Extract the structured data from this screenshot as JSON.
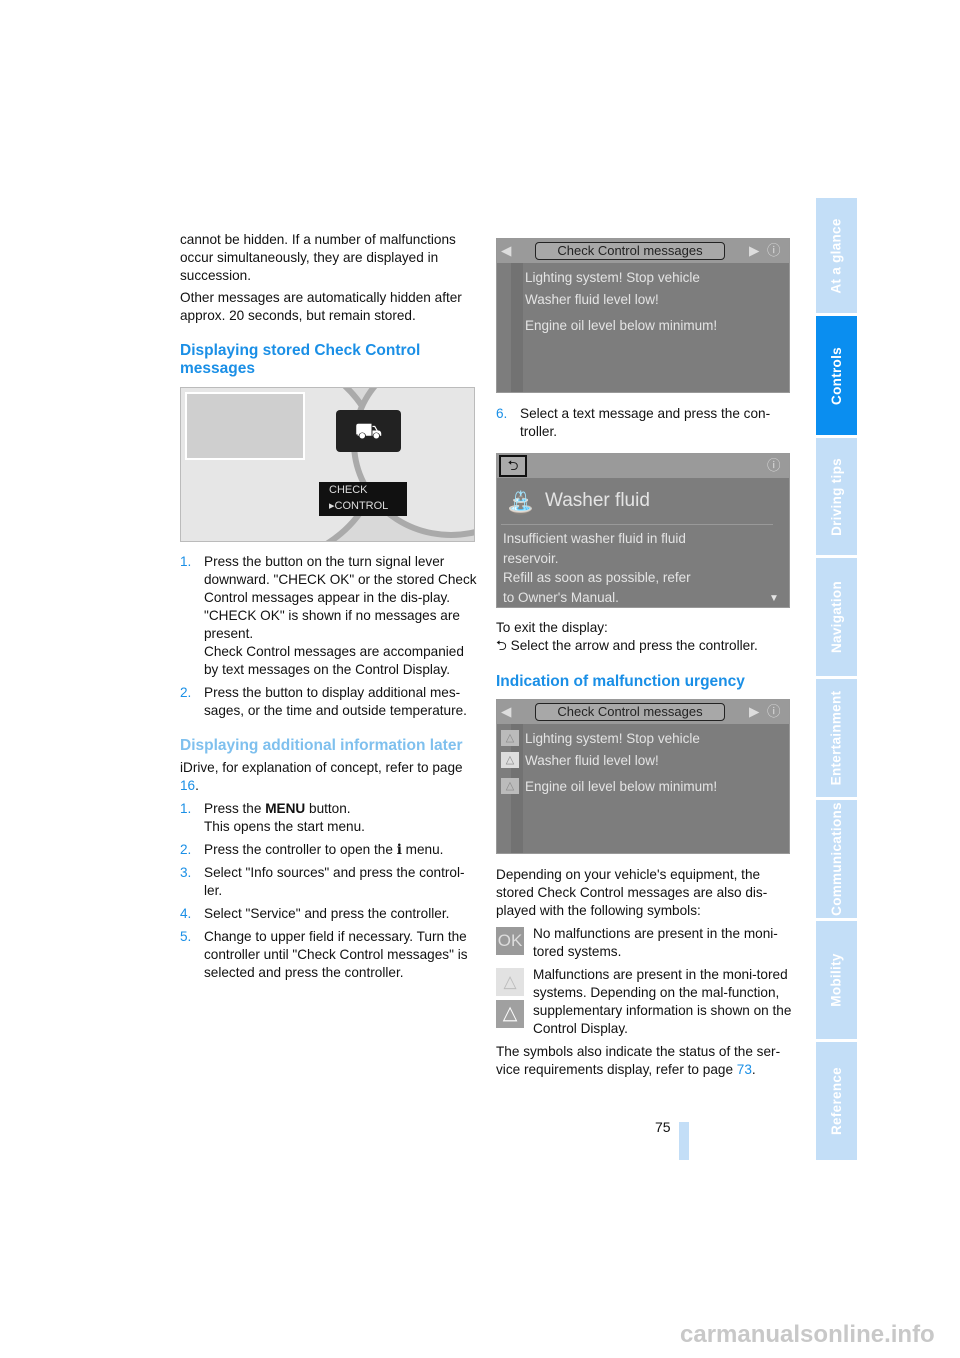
{
  "left": {
    "intro1": "cannot be hidden. If a number of malfunctions occur simultaneously, they are displayed in succession.",
    "intro2": "Other messages are automatically hidden after approx. 20 seconds, but remain stored.",
    "heading1": "Displaying stored Check Control messages",
    "cluster": {
      "line1": "CHECK",
      "line2": "▸CONTROL"
    },
    "steps1": [
      {
        "n": "1.",
        "text": "Press the button on the turn signal lever downward. \"CHECK OK\" or the stored Check Control messages appear in the dis-play.",
        "text2": "\"CHECK OK\" is shown if no messages are present.",
        "text3": "Check Control messages are accompanied by text messages on the Control Display."
      },
      {
        "n": "2.",
        "text": "Press the button to display additional mes-sages, or the time and outside temperature."
      }
    ],
    "heading2": "Displaying additional information later",
    "idrive_pre": "iDrive, for explanation of concept, refer to page ",
    "idrive_page": "16",
    "idrive_post": ".",
    "steps2": [
      {
        "n": "1.",
        "pre": "Press the ",
        "bold": "MENU",
        "post": " button.",
        "text2": "This opens the start menu."
      },
      {
        "n": "2.",
        "pre": "Press the controller to open the ",
        "icon": "i",
        "post": " menu."
      },
      {
        "n": "3.",
        "text": "Select \"Info sources\" and press the control-ler."
      },
      {
        "n": "4.",
        "text": "Select \"Service\" and press the controller."
      },
      {
        "n": "5.",
        "text": "Change to upper field if necessary. Turn the controller until \"Check Control messages\" is selected and press the controller."
      }
    ]
  },
  "right": {
    "screen1": {
      "title": "Check Control messages",
      "messages": [
        "Lighting system! Stop vehicle",
        "Washer fluid level low!",
        "Engine oil level below minimum!"
      ]
    },
    "step6": {
      "n": "6.",
      "text": "Select a text message and press the con-troller."
    },
    "screen2": {
      "title": "Washer fluid",
      "body": [
        "Insufficient washer fluid in fluid",
        "reservoir.",
        "Refill as soon as possible, refer",
        "to Owner's Manual."
      ]
    },
    "exit1": "To exit the display:",
    "exit2": "Select the arrow and press the controller.",
    "heading3": "Indication of malfunction urgency",
    "screen3": {
      "title": "Check Control messages",
      "messages": [
        "Lighting system! Stop vehicle",
        "Washer fluid level low!",
        "Engine oil level below minimum!"
      ]
    },
    "depending": "Depending on your vehicle's equipment, the stored Check Control messages are also dis-played with the following symbols:",
    "ok_label": "OK",
    "sym_ok": "No malfunctions are present in the moni-tored systems.",
    "sym_warn": "Malfunctions are present in the moni-tored systems. Depending on the mal-function, supplementary information is shown on the Control Display.",
    "status_pre": "The symbols also indicate the status of the ser-vice requirements display, refer to page ",
    "status_page": "73",
    "status_post": "."
  },
  "page_number": "75",
  "tabs": [
    "At a glance",
    "Controls",
    "Driving tips",
    "Navigation",
    "Entertainment",
    "Communications",
    "Mobility",
    "Reference"
  ],
  "active_tab": "Controls",
  "watermark": "carmanualsonline.info",
  "colors": {
    "accent": "#1a8fe6",
    "tab": "#c3def7",
    "tab_active": "#0a8ef0"
  }
}
